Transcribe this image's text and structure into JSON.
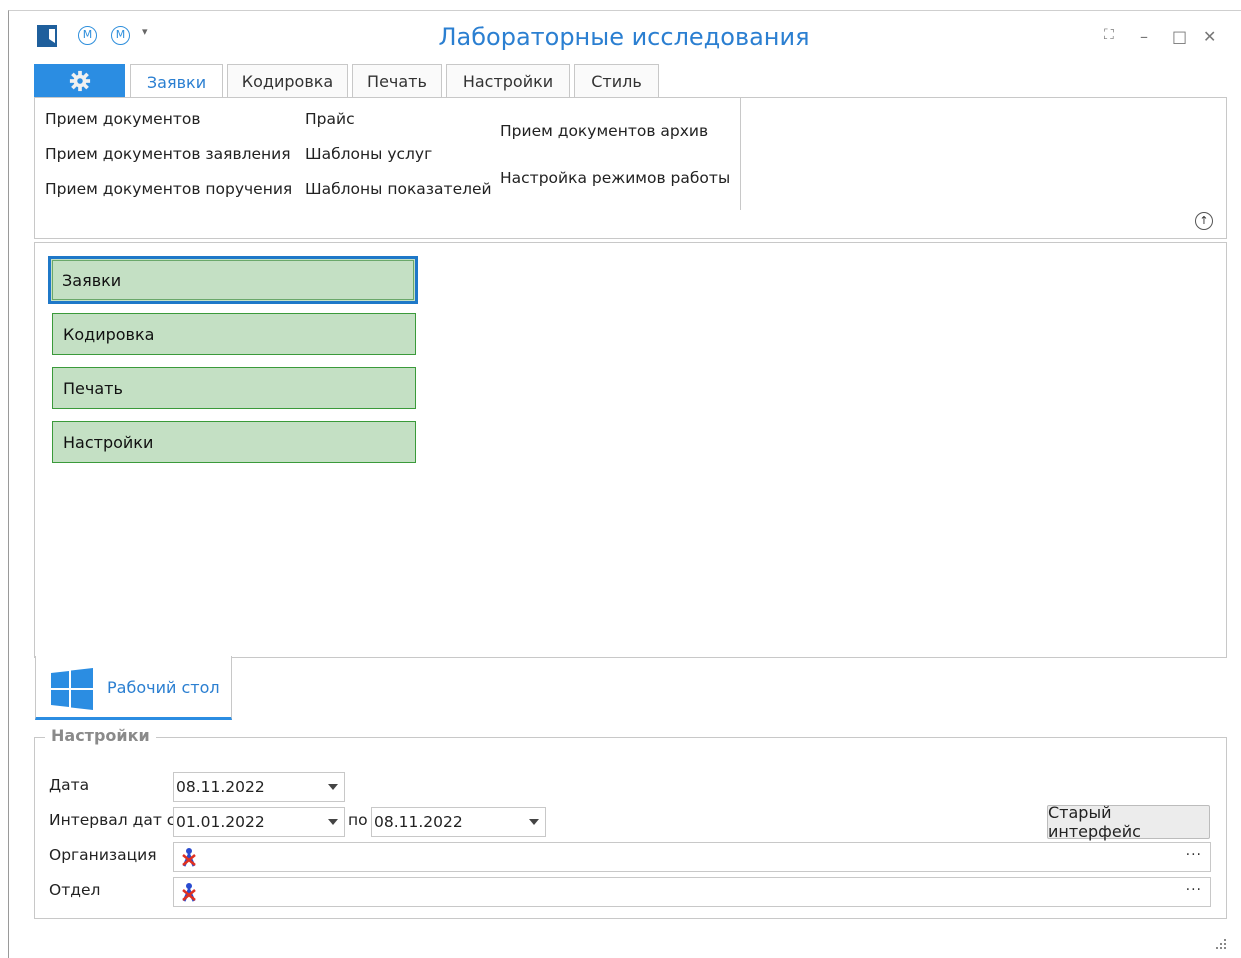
{
  "app": {
    "title": "Лабораторные исследования"
  },
  "quick_access": {
    "m1": "М",
    "m2": "М",
    "dropdown": "▾"
  },
  "window_controls": {
    "fullscreen": "⛶",
    "minimize": "–",
    "maximize": "□",
    "close": "✕"
  },
  "ribbon": {
    "tabs": [
      {
        "label": "Заявки",
        "active": true
      },
      {
        "label": "Кодировка",
        "active": false
      },
      {
        "label": "Печать",
        "active": false
      },
      {
        "label": "Настройки",
        "active": false
      },
      {
        "label": "Стиль",
        "active": false
      }
    ],
    "items": {
      "col1": [
        "Прием документов",
        "Прием документов заявления",
        "Прием документов поручения"
      ],
      "col2": [
        "Прайс",
        "Шаблоны услуг",
        "Шаблоны показателей"
      ],
      "col3": [
        "Прием документов архив",
        "Настройка режимов работы"
      ]
    },
    "collapse_icon": "↑"
  },
  "main": {
    "buttons": [
      "Заявки",
      "Кодировка",
      "Печать",
      "Настройки"
    ]
  },
  "bottom_tab": {
    "label": "Рабочий стол"
  },
  "settings": {
    "title": "Настройки",
    "date_label": "Дата",
    "date_value": "08.11.2022",
    "interval_label": "Интервал дат с",
    "interval_from": "01.01.2022",
    "interval_to_label": "по",
    "interval_to": "08.11.2022",
    "old_ui_button": "Старый интерфейс",
    "org_label": "Организация",
    "dept_label": "Отдел",
    "ellipsis": "···"
  },
  "colors": {
    "accent": "#2b8de2",
    "title_blue": "#2b7fd1",
    "green_button_bg": "#c4e0c4",
    "green_button_border": "#3a9a3a"
  }
}
